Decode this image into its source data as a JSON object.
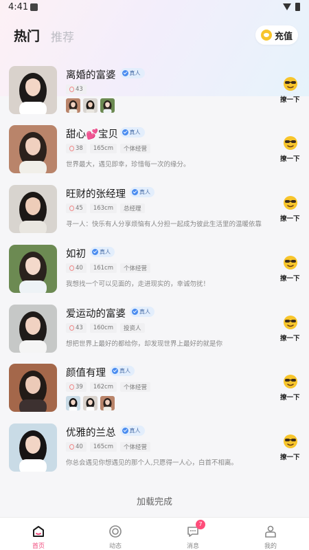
{
  "status_bar": {
    "time": "4:41"
  },
  "header": {
    "tab_hot": "热门",
    "tab_recommend": "推荐",
    "recharge_label": "充值"
  },
  "verified_label": "真人",
  "poke_label": "撩一下",
  "users": [
    {
      "nickname": "离婚的富婆",
      "age": "43",
      "height": "",
      "job": "",
      "bio": "",
      "photos": 3
    },
    {
      "nickname": "甜心💕宝贝",
      "age": "38",
      "height": "165cm",
      "job": "个体经营",
      "bio": "世界最大，遇见即幸，珍惜每一次的缘分。",
      "photos": 0
    },
    {
      "nickname": "旺财的张经理",
      "age": "45",
      "height": "163cm",
      "job": "总经理",
      "bio": "寻一人：快乐有人分享烦恼有人分担一起成为彼此生活里的温暖依靠",
      "photos": 0
    },
    {
      "nickname": "如初",
      "age": "40",
      "height": "161cm",
      "job": "个体经营",
      "bio": "我想找一个可以见面的，走进现实的，幸诚勿扰！",
      "photos": 0
    },
    {
      "nickname": "爱运动的富婆",
      "age": "43",
      "height": "160cm",
      "job": "投资人",
      "bio": "想把世界上最好的都给你，却发现世界上最好的就是你",
      "photos": 0
    },
    {
      "nickname": "颜值有理",
      "age": "39",
      "height": "162cm",
      "job": "个体经营",
      "bio": "",
      "photos": 3
    },
    {
      "nickname": "优雅的兰总",
      "age": "40",
      "height": "165cm",
      "job": "个体经营",
      "bio": "你总会遇见你想遇见的那个人,只愿得一人心，白首不相离。",
      "photos": 0
    }
  ],
  "footer": {
    "load_done": "加载完成"
  },
  "bottom_nav": {
    "home": "首页",
    "moments": "动态",
    "messages": "消息",
    "messages_badge": "7",
    "mine": "我的"
  },
  "colors": {
    "accent": "#f04a7c",
    "verified": "#4a8cf0",
    "coin": "#f7c52c"
  }
}
